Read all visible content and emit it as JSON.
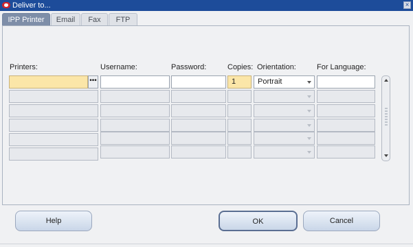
{
  "window": {
    "title": "Deliver to...",
    "close_label": "×"
  },
  "tabs": [
    {
      "label": "IPP Printer"
    },
    {
      "label": "Email"
    },
    {
      "label": "Fax"
    },
    {
      "label": "FTP"
    }
  ],
  "columns": {
    "printers": "Printers:",
    "username": "Username:",
    "password": "Password:",
    "copies": "Copies:",
    "orientation": "Orientation:",
    "language": "For Language:"
  },
  "rows": [
    {
      "printer": "",
      "username": "",
      "password": "",
      "copies": "1",
      "orientation": "Portrait",
      "language": ""
    },
    {
      "printer": "",
      "username": "",
      "password": "",
      "copies": "",
      "orientation": "",
      "language": ""
    },
    {
      "printer": "",
      "username": "",
      "password": "",
      "copies": "",
      "orientation": "",
      "language": ""
    },
    {
      "printer": "",
      "username": "",
      "password": "",
      "copies": "",
      "orientation": "",
      "language": ""
    },
    {
      "printer": "",
      "username": "",
      "password": "",
      "copies": "",
      "orientation": "",
      "language": ""
    },
    {
      "printer": "",
      "username": "",
      "password": "",
      "copies": "",
      "orientation": "",
      "language": ""
    }
  ],
  "lov_label": "•••",
  "buttons": {
    "help": "Help",
    "ok": "OK",
    "cancel": "Cancel"
  }
}
